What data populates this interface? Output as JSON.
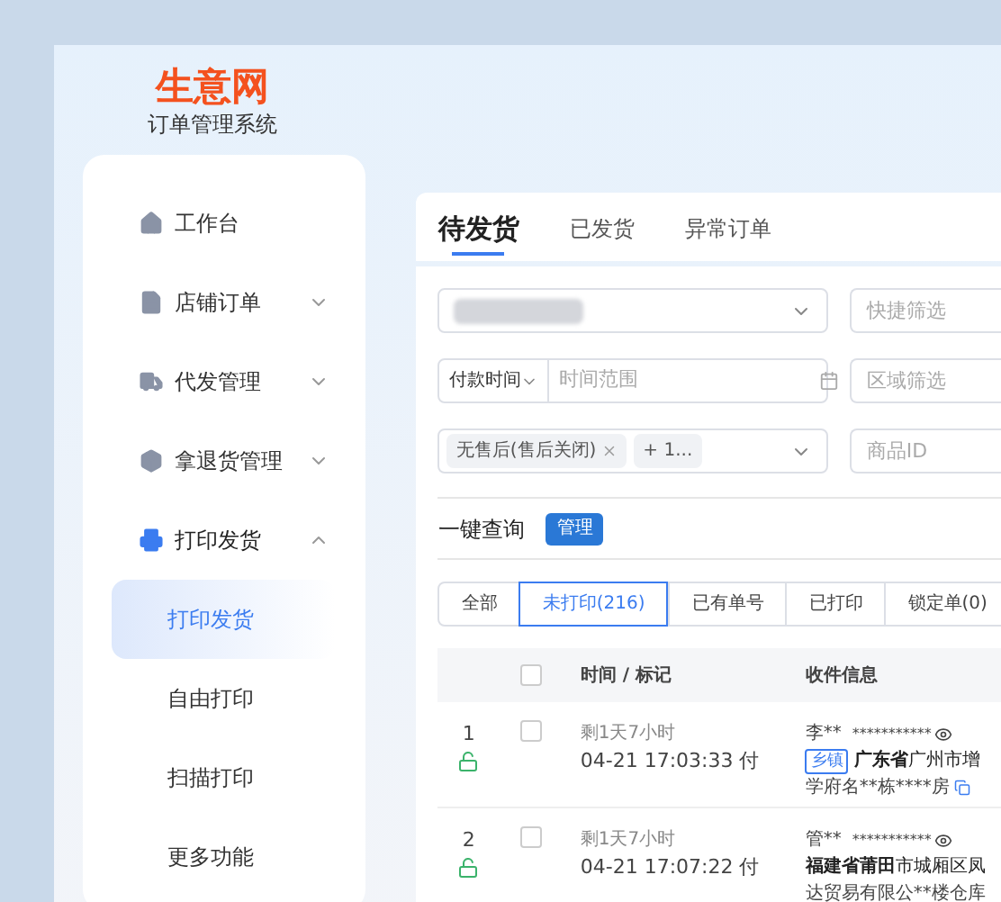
{
  "logo": {
    "brand": "生意网",
    "subtitle": "订单管理系统"
  },
  "sidebar": {
    "items": [
      {
        "label": "工作台",
        "kind": "link",
        "active": false
      },
      {
        "label": "店铺订单",
        "kind": "group",
        "expanded": false,
        "active": false
      },
      {
        "label": "代发管理",
        "kind": "group",
        "expanded": false,
        "active": false
      },
      {
        "label": "拿退货管理",
        "kind": "group",
        "expanded": false,
        "active": false
      },
      {
        "label": "打印发货",
        "kind": "group",
        "expanded": true,
        "active": true,
        "children": [
          {
            "label": "打印发货",
            "selected": true
          },
          {
            "label": "自由打印",
            "selected": false
          },
          {
            "label": "扫描打印",
            "selected": false
          },
          {
            "label": "更多功能",
            "selected": false
          }
        ]
      }
    ]
  },
  "tabs": [
    {
      "label": "待发货",
      "selected": true
    },
    {
      "label": "已发货",
      "selected": false
    },
    {
      "label": "异常订单",
      "selected": false
    }
  ],
  "filters": {
    "quick_filter": {
      "placeholder": "快捷筛选"
    },
    "time_type": {
      "value": "付款时间"
    },
    "time_range": {
      "placeholder": "时间范围"
    },
    "area": {
      "placeholder": "区域筛选"
    },
    "status_tags": [
      {
        "label": "无售后(售后关闭)",
        "removable": true
      },
      {
        "label": "+ 1...",
        "removable": false
      }
    ],
    "product_id": {
      "placeholder": "商品ID"
    }
  },
  "query": {
    "label": "一键查询",
    "button": "管理"
  },
  "segments": [
    {
      "label": "全部",
      "selected": false
    },
    {
      "label": "未打印(216)",
      "selected": true
    },
    {
      "label": "已有单号",
      "selected": false
    },
    {
      "label": "已打印",
      "selected": false
    },
    {
      "label": "锁定单(0)",
      "selected": false
    }
  ],
  "table": {
    "columns": [
      "时间 / 标记",
      "收件信息"
    ],
    "header_checked": false,
    "rows": [
      {
        "index": "1",
        "locked": false,
        "checked": false,
        "remaining": "剩1天7小时",
        "time": "04-21 17:03:33 付",
        "name": "李**",
        "phone": "***********",
        "tag": "乡镇",
        "address_bold": "广东省",
        "address": "广州市增",
        "address_line": "学府名**栋****房",
        "copyable": true
      },
      {
        "index": "2",
        "locked": false,
        "checked": false,
        "remaining": "剩1天7小时",
        "time": "04-21 17:07:22 付",
        "name": "管**",
        "phone": "***********",
        "address_bold": "福建省莆田",
        "address": "市城厢区凤",
        "address_line": "达贸易有限公**楼仓库",
        "copyable": false
      }
    ]
  }
}
